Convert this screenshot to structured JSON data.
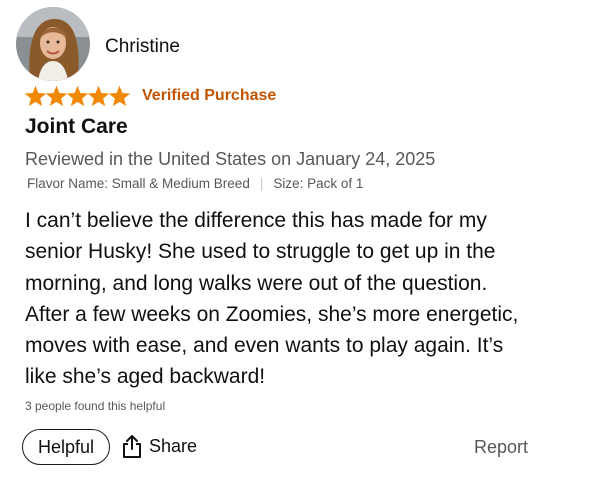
{
  "reviewer": {
    "name": "Christine"
  },
  "rating": {
    "stars": 5,
    "max_stars": 5,
    "color": "#f08804"
  },
  "verified_label": "Verified Purchase",
  "review": {
    "title": "Joint Care",
    "meta": "Reviewed in the United States on January 24, 2025",
    "flavor": "Flavor Name: Small & Medium Breed",
    "size": "Size: Pack of 1",
    "body_lines": [
      "I can’t believe the difference this has made for my",
      "senior Husky! She used to struggle to get up in the",
      "morning, and long walks were out of the question.",
      "After a few weeks on Zoomies, she’s more energetic,",
      "moves with ease, and even wants to play again. It’s",
      "like she’s aged backward!"
    ],
    "helpful_count_text": "3 people found this helpful"
  },
  "actions": {
    "helpful_label": "Helpful",
    "share_label": "Share",
    "report_label": "Report"
  },
  "colors": {
    "verified": "#c45500",
    "text": "#0f1111",
    "secondary": "#565959"
  }
}
